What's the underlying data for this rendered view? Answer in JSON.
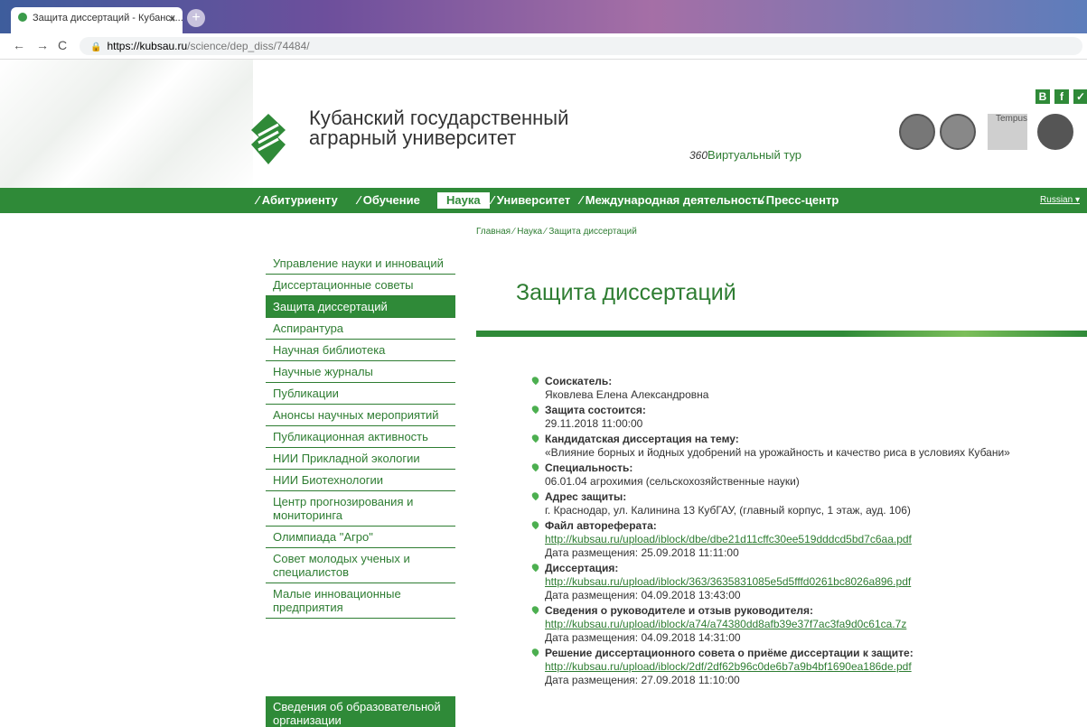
{
  "browser": {
    "tab_title": "Защита диссертаций - Кубанск...",
    "tab_close": "×",
    "new_tab": "+",
    "url_domain": "https://kubsau.ru",
    "url_path": "/science/dep_diss/74484/"
  },
  "header": {
    "univ_line1": "Кубанский государственный",
    "univ_line2": "аграрный университет",
    "tour_badge": "360",
    "tour_label": "Виртуальный тур",
    "social": [
      "B",
      "f",
      "✓"
    ],
    "tempus_label": "Tempus"
  },
  "nav": {
    "items": [
      "Абитуриенту",
      "Обучение",
      "Наука",
      "Университет",
      "Международная деятельность",
      "Пресс-центр"
    ],
    "lang": "Russian"
  },
  "breadcrumb": "Главная ⁄ Наука ⁄ Защита диссертаций",
  "sidebar": {
    "items": [
      "Управление науки и инноваций",
      "Диссертационные советы",
      "Защита диссертаций",
      "Аспирантура",
      "Научная библиотека",
      "Научные журналы",
      "Публикации",
      "Анонсы научных мероприятий",
      "Публикационная активность",
      "НИИ Прикладной экологии",
      "НИИ Биотехнологии",
      "Центр прогнозирования и мониторинга",
      "Олимпиада \"Агро\"",
      "Совет молодых ученых и специалистов",
      "Малые инновационные предприятия"
    ],
    "info": "Сведения об образовательной организации"
  },
  "content": {
    "title": "Защита диссертаций",
    "details": [
      {
        "label": "Соискатель:",
        "value": "Яковлева Елена Александровна"
      },
      {
        "label": "Защита состоится:",
        "value": "29.11.2018 11:00:00"
      },
      {
        "label": "Кандидатская диссертация на тему:",
        "value": "«Влияние борных и йодных удобрений на урожайность и качество риса в условиях Кубани»"
      },
      {
        "label": "Специальность:",
        "value": "06.01.04 агрохимия (сельскохозяйственные науки)"
      },
      {
        "label": "Адрес защиты:",
        "value": "г. Краснодар, ул. Калинина 13 КубГАУ, (главный корпус, 1 этаж, ауд. 106)"
      },
      {
        "label": "Файл автореферата:",
        "link": "http://kubsau.ru/upload/iblock/dbe/dbe21d11cffc30ee519dddcd5bd7c6aa.pdf",
        "date": "Дата размещения: 25.09.2018 11:11:00"
      },
      {
        "label": "Диссертация:",
        "link": "http://kubsau.ru/upload/iblock/363/3635831085e5d5fffd0261bc8026a896.pdf",
        "date": "Дата размещения: 04.09.2018 13:43:00"
      },
      {
        "label": "Сведения о руководителе и отзыв руководителя:",
        "link": "http://kubsau.ru/upload/iblock/a74/a74380dd8afb39e37f7ac3fa9d0c61ca.7z",
        "date": "Дата размещения: 04.09.2018 14:31:00"
      },
      {
        "label": "Решение диссертационного совета о приёме диссертации к защите:",
        "link": "http://kubsau.ru/upload/iblock/2df/2df62b96c0de6b7a9b4bf1690ea186de.pdf",
        "date": "Дата размещения: 27.09.2018 11:10:00"
      }
    ]
  },
  "colors": {
    "brand_green": "#2f8a38",
    "link_green": "#2e7d32"
  }
}
